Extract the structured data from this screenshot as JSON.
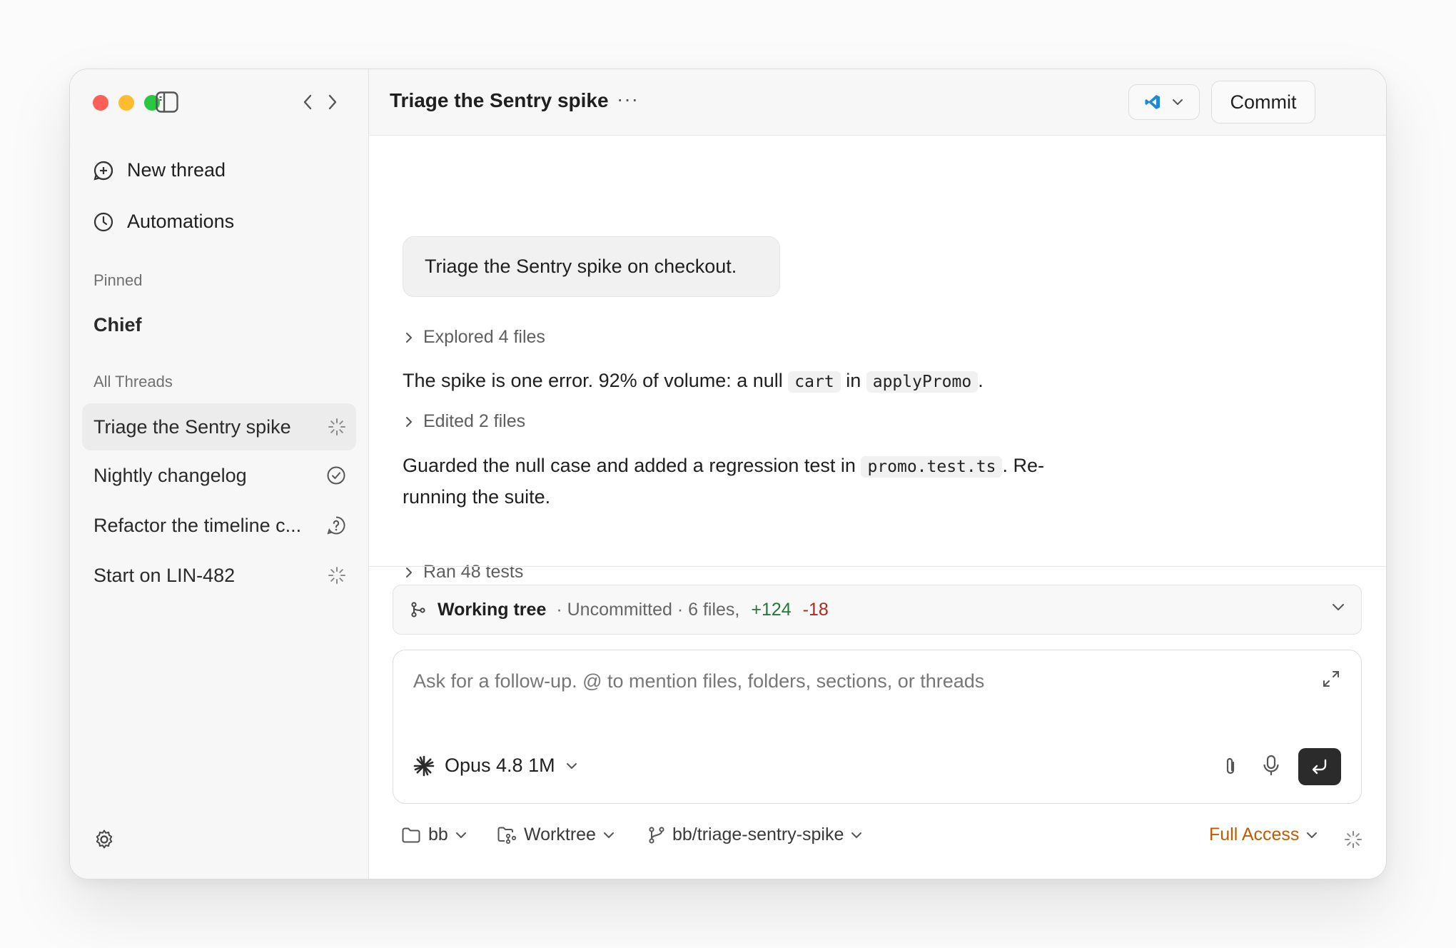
{
  "sidebar": {
    "nav": [
      {
        "label": "New thread",
        "icon": "new-thread-icon"
      },
      {
        "label": "Automations",
        "icon": "clock-icon"
      }
    ],
    "pinned_label": "Pinned",
    "pinned": [
      {
        "label": "Chief"
      }
    ],
    "all_threads_label": "All Threads",
    "threads": [
      {
        "label": "Triage the Sentry spike",
        "status_icon": "spinner-icon",
        "active": true
      },
      {
        "label": "Nightly changelog",
        "status_icon": "check-circle-icon"
      },
      {
        "label": "Refactor the timeline c...",
        "status_icon": "question-bubble-icon"
      },
      {
        "label": "Start on LIN-482",
        "status_icon": "spinner-icon"
      }
    ]
  },
  "header": {
    "title": "Triage the Sentry spike",
    "more_label": "···",
    "commit_label": "Commit"
  },
  "conversation": {
    "user_message": "Triage the Sentry spike on checkout.",
    "step1": "Explored 4 files",
    "para1_pre": "The spike is one error. 92% of volume: a null",
    "para1_code1": "cart",
    "para1_mid": "in",
    "para1_code2": "applyPromo",
    "para1_post": ".",
    "step2": "Edited 2 files",
    "para2_line1_pre": "Guarded the null case and added a regression test in",
    "para2_code": "promo.test.ts",
    "para2_line1_post": ". Re-",
    "para2_line2": "running the suite.",
    "step3": "Ran 48 tests"
  },
  "working_tree": {
    "title": "Working tree",
    "meta": "· Uncommitted · 6 files,",
    "additions": "+124",
    "deletions": "-18"
  },
  "composer": {
    "placeholder": "Ask for a follow-up. @ to mention files, folders, sections, or threads",
    "model": "Opus 4.8 1M"
  },
  "footer": {
    "project": "bb",
    "workspace": "Worktree",
    "branch": "bb/triage-sentry-spike",
    "access": "Full Access"
  },
  "colors": {
    "accent_access": "#c35a00",
    "additions": "#1f7a3a",
    "deletions": "#b3261e",
    "vscode_blue": "#1f8ad2"
  }
}
